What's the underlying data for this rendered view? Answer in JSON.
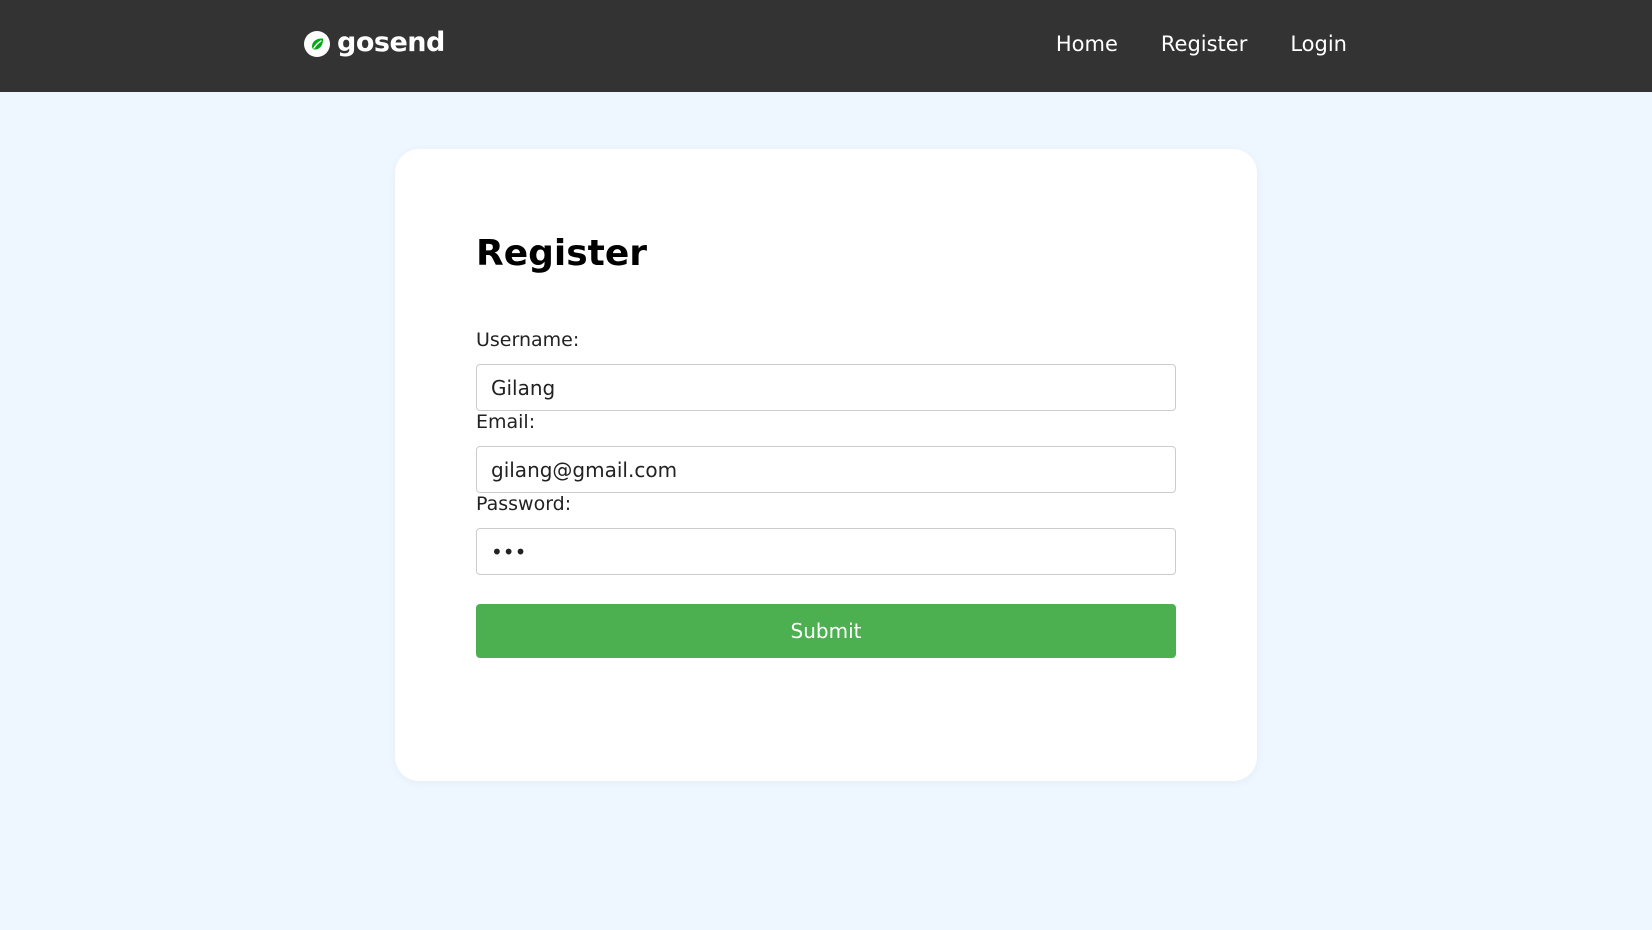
{
  "navbar": {
    "brand_name": "gosend",
    "brand_icon": "gosend-logo-icon",
    "links": [
      {
        "label": "Home"
      },
      {
        "label": "Register"
      },
      {
        "label": "Login"
      }
    ]
  },
  "form": {
    "title": "Register",
    "username": {
      "label": "Username:",
      "value": "Gilang"
    },
    "email": {
      "label": "Email:",
      "value": "gilang@gmail.com"
    },
    "password": {
      "label": "Password:",
      "value": "•••"
    },
    "submit_label": "Submit"
  },
  "colors": {
    "navbar_bg": "#333333",
    "page_bg": "#eef6ff",
    "accent_green": "#4caf50",
    "logo_green": "#00aa13"
  }
}
